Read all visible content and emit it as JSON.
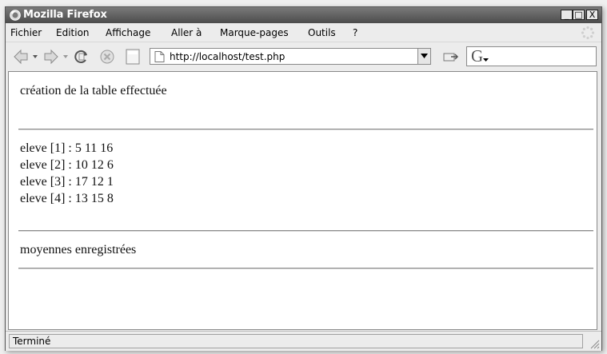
{
  "window": {
    "title": "Mozilla Firefox",
    "min_label": "_",
    "max_label": "□",
    "close_label": "X"
  },
  "menu": {
    "items": [
      {
        "label": "Fichier"
      },
      {
        "label": "Edition"
      },
      {
        "label": "Affichage"
      },
      {
        "label": "Aller à"
      },
      {
        "label": "Marque-pages"
      },
      {
        "label": "Outils"
      },
      {
        "label": "?"
      }
    ]
  },
  "toolbar": {
    "url": "http://localhost/test.php",
    "search_engine_letter": "G",
    "icons": [
      "back-icon",
      "forward-icon",
      "reload-icon",
      "stop-icon",
      "page-icon",
      "go-icon",
      "google-icon"
    ]
  },
  "content": {
    "creation_msg": "création de la table effectuée",
    "eleves": [
      {
        "text": "eleve [1] : 5 11 16"
      },
      {
        "text": "eleve [2] : 10 12 6"
      },
      {
        "text": "eleve [3] : 17 12 1"
      },
      {
        "text": "eleve [4] : 13 15 8"
      }
    ],
    "moyennes_msg": "moyennes enregistrées"
  },
  "status": {
    "text": "Terminé"
  },
  "colors": {
    "titlebar": "#5a5a5a",
    "chrome": "#ececec"
  }
}
